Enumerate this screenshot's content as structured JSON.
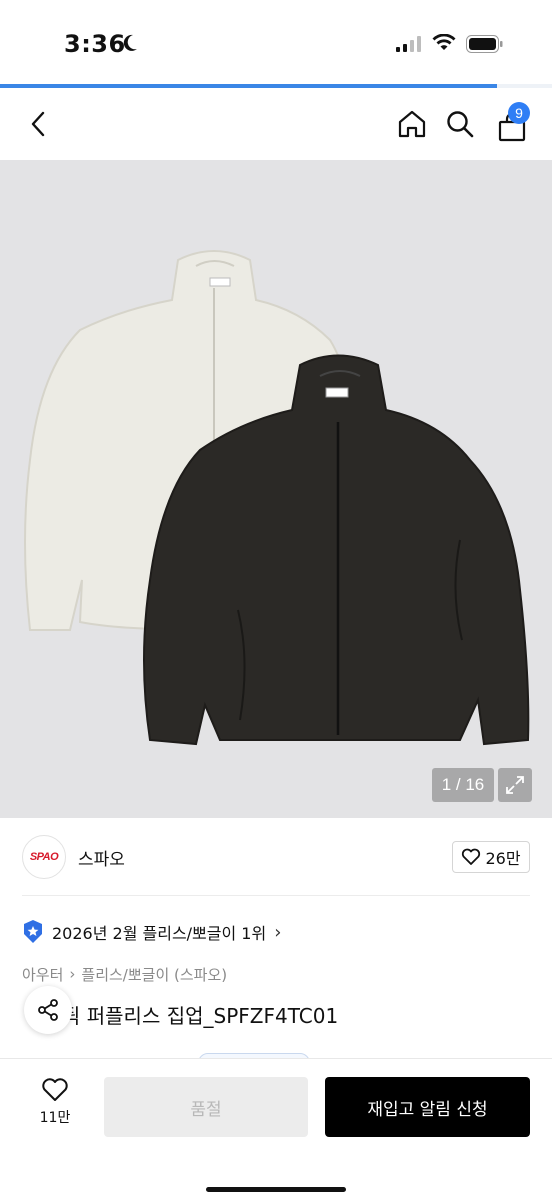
{
  "status": {
    "time": "3:36"
  },
  "page_load_progress": 0.9,
  "nav": {
    "cart_count": "9"
  },
  "gallery": {
    "counter": "1 / 16"
  },
  "brand": {
    "logo_text": "SPAO",
    "name": "스파오",
    "likes": "26만"
  },
  "ranking": {
    "text": "2026년 2월 플리스/뽀글이 1위"
  },
  "breadcrumb": {
    "level1": "아우터",
    "level2": "플리스/뽀글이 (스파오)"
  },
  "product": {
    "title": "뒥 퍼플리스 집업_SPFZF4TC01"
  },
  "bottom_bar": {
    "wish_count": "11만",
    "soldout_label": "품절",
    "restock_label": "재입고 알림 신청"
  },
  "colors": {
    "accent": "#2f7ef5",
    "brand": "#d7192a",
    "cta": "#000000"
  }
}
